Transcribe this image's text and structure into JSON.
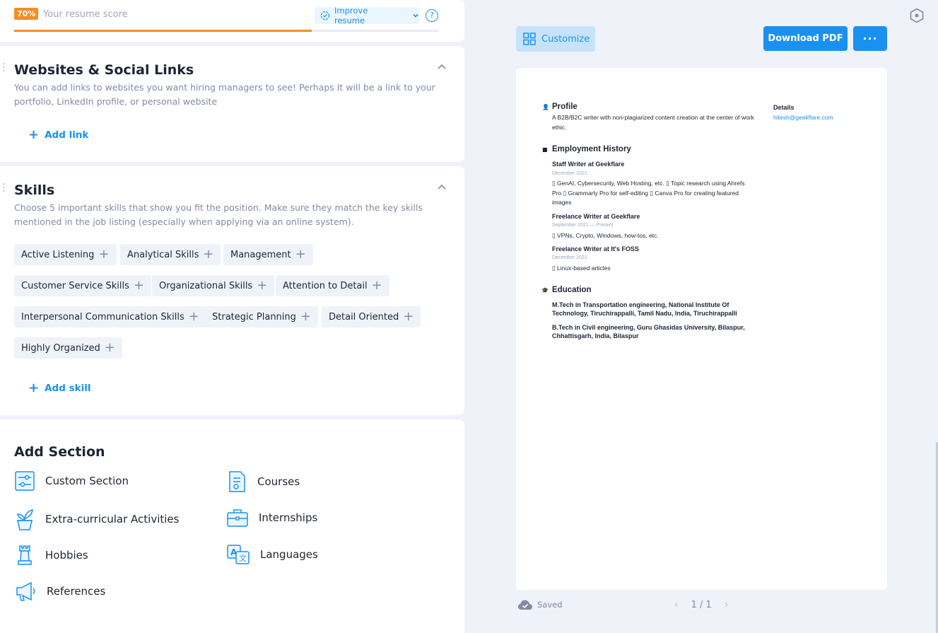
{
  "score": {
    "percent_label": "70%",
    "label": "Your resume score",
    "progress": 0.7,
    "improve_label": "Improve resume",
    "help_label": "?"
  },
  "links_section": {
    "title": "Websites & Social Links",
    "description": "You can add links to websites you want hiring managers to see! Perhaps It will be a link to your portfolio, LinkedIn profile, or personal website",
    "add_label": "Add link"
  },
  "skills_section": {
    "title": "Skills",
    "description": "Choose 5 important skills that show you fit the position. Make sure they match the key skills mentioned in the job listing (especially when applying via an online system).",
    "chips": [
      "Active Listening",
      "Analytical Skills",
      "Management",
      "Customer Service Skills",
      "Organizational Skills",
      "Attention to Detail",
      "Interpersonal Communication Skills",
      "Strategic Planning",
      "Detail Oriented",
      "Highly Organized"
    ],
    "add_label": "Add skill"
  },
  "add_section": {
    "title": "Add Section",
    "items": [
      {
        "label": "Custom Section",
        "icon": "sliders-icon"
      },
      {
        "label": "Courses",
        "icon": "certificate-icon"
      },
      {
        "label": "Extra-curricular Activities",
        "icon": "plant-icon"
      },
      {
        "label": "Internships",
        "icon": "briefcase-icon"
      },
      {
        "label": "Hobbies",
        "icon": "chess-rook-icon"
      },
      {
        "label": "Languages",
        "icon": "translate-icon"
      },
      {
        "label": "References",
        "icon": "megaphone-icon"
      }
    ]
  },
  "toolbar": {
    "customize_label": "Customize",
    "download_label": "Download PDF",
    "more_label": "···"
  },
  "status": {
    "saved_label": "Saved",
    "page_indicator": "1 / 1"
  },
  "resume": {
    "profile_heading": "Profile",
    "profile_text": "A B2B/B2C writer with non-plagiarized content creation at the center of work ethic.",
    "details_heading": "Details",
    "email": "hitesh@geekflare.com",
    "employment_heading": "Employment History",
    "jobs": [
      {
        "title": "Staff Writer at Geekflare",
        "date": "December 2021",
        "lines": [
          "▯ GenAI, Cybersecurity, Web Hosting, etc. ▯  Topic research using Ahrefs",
          "Pro ▯  Grammarly Pro for self-editing ▯  Canva Pro for creating featured",
          "images"
        ]
      },
      {
        "title": "Freelance Writer at Geekflare",
        "date": "September 2021 — Present",
        "lines": [
          "▯ VPNs, Crypto, Windows, how-tos, etc."
        ]
      },
      {
        "title": "Freelance Writer at It's FOSS",
        "date": "December 2021",
        "lines": [
          "▯ Linux-based articles"
        ]
      }
    ],
    "education_heading": "Education",
    "education": [
      [
        "M.Tech in Transportation engineering, National Institute Of",
        "Technology, Tiruchirappalli, Tamil Nadu, India, Tiruchirappalli"
      ],
      [
        "B.Tech in Civil engineering, Guru Ghasidas University, Bilaspur,",
        "Chhattisgarh, India, Bilaspur"
      ]
    ]
  },
  "colors": {
    "accent": "#1a91f0",
    "score": "#f68d27"
  }
}
